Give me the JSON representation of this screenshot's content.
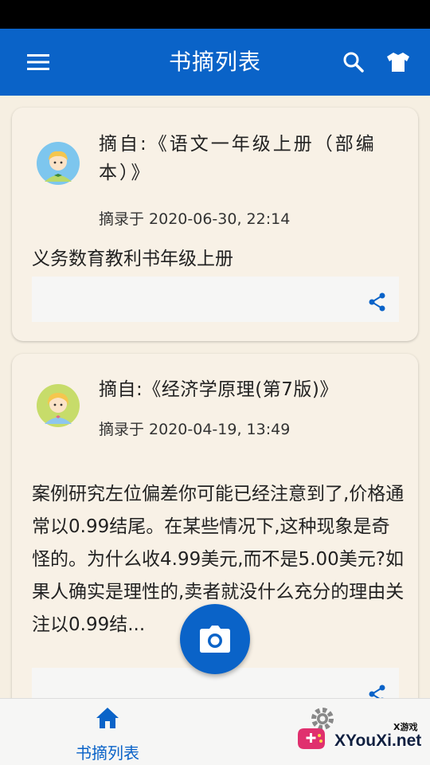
{
  "app_bar": {
    "title": "书摘列表",
    "menu_icon": "hamburger-menu-icon",
    "search_icon": "search-icon",
    "theme_icon": "tshirt-icon"
  },
  "excerpts": [
    {
      "source": "摘自:《语文一年级上册（部编本）》",
      "date": "摘录于 2020-06-30, 22:14",
      "text": "义务数育教利书年级上册",
      "avatar_icon": "boy-avatar-icon",
      "share_icon": "share-icon"
    },
    {
      "source": "摘自:《经济学原理(第7版)》",
      "date": "摘录于 2020-04-19, 13:49",
      "text": "案例研究左位偏差你可能已经注意到了,价格通常以0.99结尾。在某些情况下,这种现象是奇怪的。为什么收4.99美元,而不是5.00美元?如果人确实是理性的,卖者就没什么充分的理由关注以0.99结...",
      "avatar_icon": "girl-avatar-icon",
      "share_icon": "share-icon"
    }
  ],
  "fab": {
    "icon": "camera-icon"
  },
  "bottom_nav": {
    "home_label": "书摘列表",
    "home_icon": "home-icon",
    "settings_icon": "gear-icon"
  },
  "watermark": {
    "small_text": "X游戏",
    "text": "XYouXi.net"
  },
  "colors": {
    "primary": "#0a63c8",
    "background": "#f6efe2",
    "card": "#f8f1e6"
  }
}
